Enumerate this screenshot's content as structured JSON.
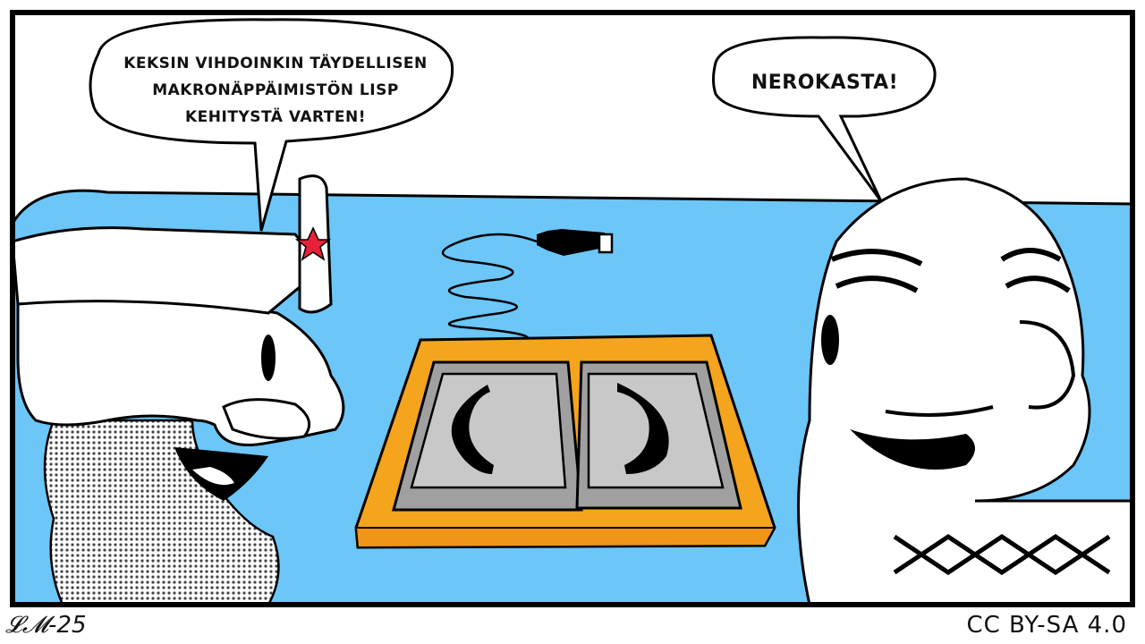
{
  "comic": {
    "speech_left": {
      "line1": "KEKSIN VIHDOINKIN TÄYDELLISEN",
      "line2": "MAKRONÄPPÄIMISTÖN LISP",
      "line3": "KEHITYSTÄ VARTEN!"
    },
    "speech_right": "NEROKASTA!",
    "signature": "𝓛𝓜-25",
    "license": "CC BY-SA 4.0",
    "keys": [
      "(",
      ")"
    ]
  },
  "colors": {
    "background": "#6cc6f7",
    "keyboard": "#f5a41d",
    "keycap": "#c8c8c8",
    "outline": "#000000",
    "star": "#e8203a"
  }
}
